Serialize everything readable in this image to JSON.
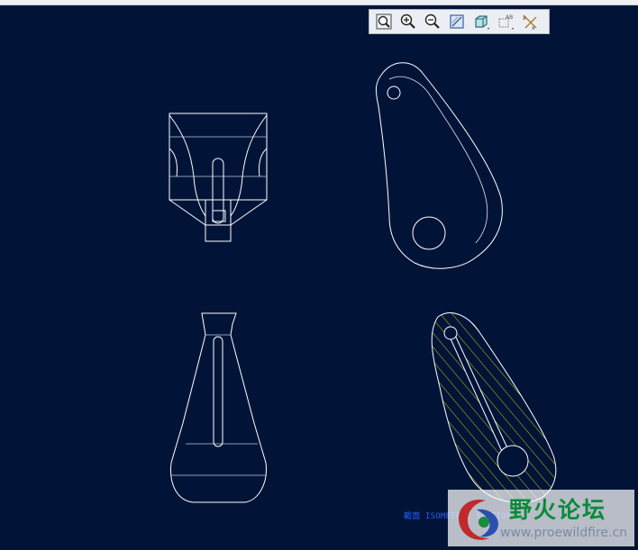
{
  "window": {
    "toolbar_tools": [
      {
        "name": "zoom-window-icon"
      },
      {
        "name": "zoom-in-icon"
      },
      {
        "name": "zoom-out-icon"
      },
      {
        "name": "repaint-icon"
      },
      {
        "name": "display-style-icon"
      },
      {
        "name": "annotation-display-icon"
      },
      {
        "name": "datum-display-icon"
      }
    ]
  },
  "drawing": {
    "background_color": "#011438",
    "line_color": "#ffffff",
    "hatch_color": "#c9c800",
    "views": [
      "top-view",
      "general-view",
      "front-view",
      "section-view"
    ],
    "note_text": "截面 ISOMETRIC SECTION"
  },
  "watermark": {
    "title": "野火论坛",
    "url": "www.proewildfire.cn",
    "title_color": "#0a8a3a"
  }
}
